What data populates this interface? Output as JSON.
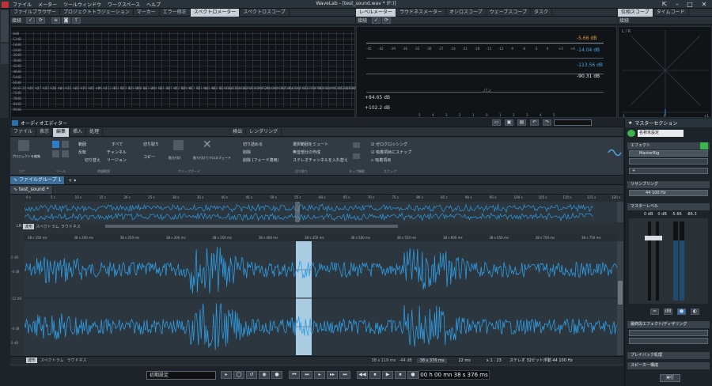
{
  "app": {
    "title": "WaveLab - [test_sound.wav * (F:)]",
    "menu": [
      "ファイル",
      "メーター",
      "ツールウィンドウ",
      "ワークスペース",
      "ヘルプ"
    ]
  },
  "top_left_panel": {
    "tabs": [
      "ファイルブラウザー",
      "プロジェクトトラジェーション",
      "マーカー",
      "エラー修正",
      "スペクトロメーター",
      "スペクトロスコープ"
    ],
    "active_tab": 4,
    "toolbar_label": "接続",
    "y_labels": [
      "-6dB",
      "-12dB",
      "-18dB",
      "-24dB",
      "-30dB",
      "-36dB",
      "-42dB",
      "-48dB",
      "-54dB",
      "-60dB",
      "-66dB",
      "-72dB",
      "-78dB",
      "-84dB",
      "-90dB"
    ],
    "x_labels": [
      "20 Hz",
      "24 Hz",
      "27 Hz",
      "33 Hz",
      "38 Hz",
      "44 Hz",
      "51 Hz",
      "60 Hz",
      "70 Hz",
      "82 Hz",
      "96 Hz",
      "112 Hz",
      "131 Hz",
      "153 Hz",
      "178 Hz",
      "208 Hz",
      "243 Hz",
      "284 Hz",
      "331 Hz",
      "387 Hz",
      "452 Hz",
      "528 Hz",
      "617 Hz",
      "721 Hz",
      "842 Hz",
      "983 Hz",
      "1148 Hz",
      "1341 Hz",
      "1566 Hz",
      "1829 Hz",
      "2136 Hz",
      "2495 Hz",
      "2914 Hz",
      "3404 Hz",
      "3975 Hz",
      "4643 Hz",
      "5423 Hz",
      "6333 Hz",
      "7397 Hz",
      "8639 Hz",
      "10090 Hz",
      "11785 Hz",
      "13765 Hz",
      "16077 Hz"
    ]
  },
  "level_meter": {
    "tabs": [
      "レベルメーター",
      "ラウドネスメーター",
      "オシロスコープ",
      "ウェーブスコープ",
      "タスク"
    ],
    "active_tab": 0,
    "toolbar_label": "接続",
    "scale": [
      "-45",
      "-42",
      "-39",
      "-36",
      "-33",
      "-30",
      "-27",
      "-24",
      "-21",
      "-18",
      "-15",
      "-12",
      "-9",
      "-6",
      "-3",
      "0",
      "+3",
      "+6"
    ],
    "readouts": [
      "-5.66 dB",
      "-14.04 dB",
      "-113.56 dB",
      "-90.31 dB"
    ],
    "pan_label": "パン",
    "pan_values": [
      "+84.65 dB",
      "+102.2 dB"
    ],
    "bottom_scale": [
      "5",
      "4",
      "3",
      "2",
      "1",
      "0",
      "1",
      "2",
      "3",
      "4",
      "5"
    ]
  },
  "phase_scope": {
    "tabs": [
      "位相スコープ",
      "タイムコード"
    ],
    "active_tab": 0,
    "toolbar_label": "接続",
    "corner_label": "L / R",
    "bottom_labels": [
      "-1",
      "0",
      "+1"
    ]
  },
  "audio_editor": {
    "title": "オーディオエディター",
    "ribbon_tabs": [
      "ファイル",
      "表示",
      "編集",
      "挿入",
      "処理",
      "検出",
      "レンダリング"
    ],
    "active_ribbon_tab": 2,
    "ribbon": {
      "project_edit": "プロジェクトを編集",
      "group_tool": "ツール",
      "group_time_select": "時間範囲",
      "group_clipboard": "クリップボード",
      "group_cut": "切り取り",
      "group_tap": "タップ機能",
      "group_snap": "スナップ",
      "group_core": "コア",
      "sel_range": "範囲",
      "sel_all": "すべて",
      "sel_toggle": "反転",
      "sel_channel": "チャンネル",
      "sel_cut_swap": "切り替え",
      "sel_region": "リージョン",
      "cut": "切り取り",
      "copy": "コピー",
      "paste": "貼り付け",
      "paste_cross": "貼り付けてクロスフェード",
      "trim": "切り詰める",
      "delete": "削除",
      "delete_fade": "削除 (フェード適用)",
      "mute_selection": "選択範囲をミュート",
      "create_silence": "無音部分の作成",
      "stereo_swap": "ステレオチャンネルを入れ替え",
      "zero_cross": "ゼロクロッシング",
      "snap_to_mag": "吸着項目にスナップ",
      "snap_item": "吸着項目"
    },
    "file_group_tab": "ファイルグループ 1",
    "file_tab": "test_sound *",
    "overview_ruler": [
      "0 s",
      "5 s",
      "10 s",
      "15 s",
      "20 s",
      "25 s",
      "30 s",
      "35 s",
      "40 s",
      "45 s",
      "50 s",
      "55 s",
      "60 s",
      "65 s",
      "70 s",
      "75 s",
      "80 s",
      "85 s",
      "90 s",
      "95 s",
      "100 s",
      "105 s",
      "110 s",
      "115 s",
      "120 s"
    ],
    "view_tabs": [
      "波形",
      "スペクトラム",
      "ラウドネス"
    ],
    "lr_label": "LR",
    "main_ruler": [
      "38 s 150 ms",
      "38 s 200 ms",
      "38 s 250 ms",
      "38 s 300 ms",
      "38 s 350 ms",
      "38 s 400 ms",
      "38 s 450 ms",
      "38 s 500 ms",
      "38 s 550 ms",
      "38 s 600 ms",
      "38 s 650 ms",
      "38 s 700 ms",
      "38 s 750 ms"
    ],
    "amp_labels": [
      "0 dB",
      "-6 dB",
      "-12 dB",
      "-6 dB",
      "0 dB"
    ],
    "status": {
      "position": "38 s 119 ms",
      "offset": "-44 dB",
      "cursor": "38 s 376 ms",
      "length": "22 ms",
      "zoom": "x 1 : 23",
      "format": "ステレオ 32ビット浮動 44 100 Hz"
    },
    "view_tabs_bottom": [
      "波形",
      "スペクトラム",
      "ラウドネス"
    ]
  },
  "master_section": {
    "title": "マスターセクション",
    "preset": "名称未設定",
    "effects_label": "エフェクト",
    "effect_slot": "MasterRig",
    "resampling_label": "リサンプリング",
    "sample_rate": "44 100 Hz",
    "master_level_label": "マスターレベル",
    "level_values": [
      "0 dB",
      "0 dB",
      "-5.66",
      "-86.3"
    ],
    "final_effects_label": "最終段エフェクト/ディザリング",
    "playback_label": "プレイバック処理",
    "speaker_label": "スピーカー構成",
    "render_button": "実行"
  },
  "transport": {
    "preset": "初期設定",
    "time": "00 h 00 mn 38 s 376 ms"
  },
  "colors": {
    "waveform": "#2f9be0",
    "selection": "#bfe6ff",
    "accent_green": "#3bb54a",
    "accent_blue": "#2a6fb0"
  }
}
